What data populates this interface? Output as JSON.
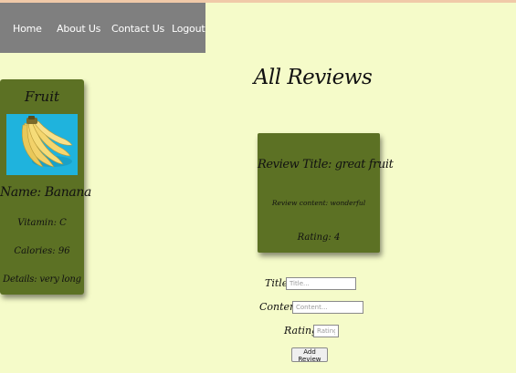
{
  "nav": {
    "items": [
      {
        "label": "Home"
      },
      {
        "label": "About Us"
      },
      {
        "label": "Contact Us"
      },
      {
        "label": "Logout"
      }
    ]
  },
  "page_title": "All Reviews",
  "fruit": {
    "heading": "Fruit",
    "image_icon": "banana-image",
    "name": "Name: Banana",
    "vitamin": "Vitamin: C",
    "calories": "Calories: 96",
    "details": "Details: very long"
  },
  "review": {
    "title": "Review Title: great fruit",
    "content": "Review content: wonderful",
    "rating": "Rating: 4"
  },
  "form": {
    "title_label": "Title",
    "title_placeholder": "Title...",
    "content_label": "Content",
    "content_placeholder": "Content...",
    "rating_label": "Rating",
    "rating_placeholder": "Rating",
    "submit_label": "Add Review"
  },
  "colors": {
    "background": "#f5fbc9",
    "nav": "#7f7f7f",
    "card": "#5c7124",
    "image_bg": "#1fb3dd"
  }
}
